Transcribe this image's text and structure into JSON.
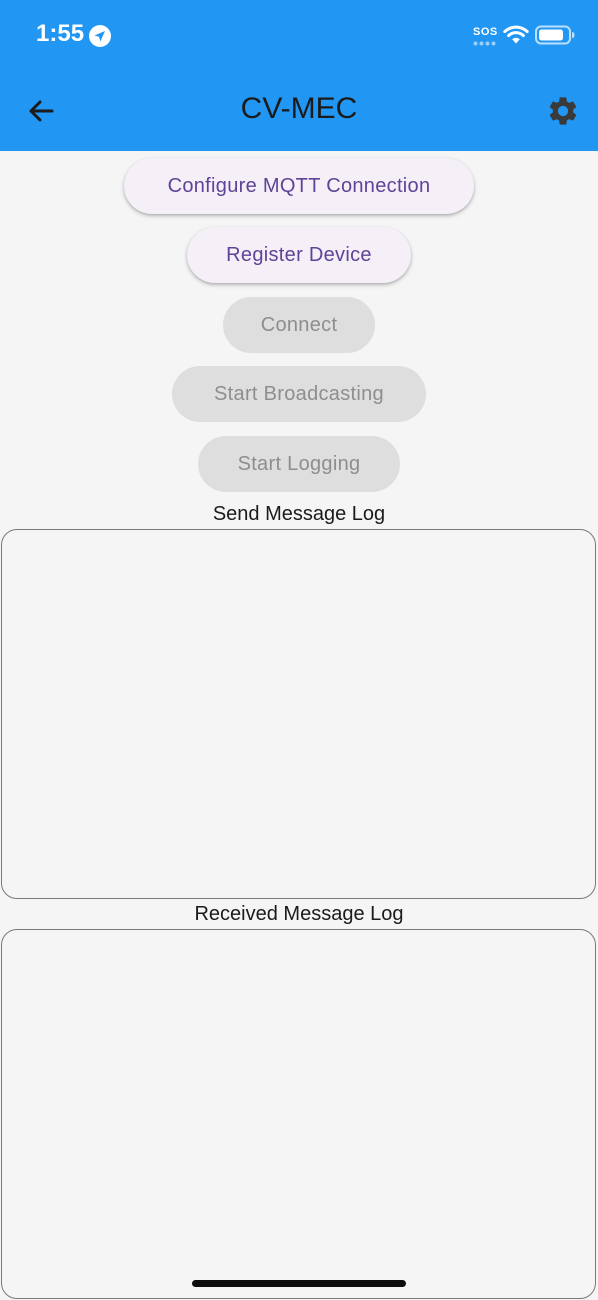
{
  "status_bar": {
    "time": "1:55",
    "sos": "SOS",
    "icons": [
      "location-arrow-icon",
      "wifi-icon",
      "battery-icon"
    ]
  },
  "app_bar": {
    "title": "CV-MEC",
    "back_icon": "arrow-left-icon",
    "settings_icon": "gear-icon",
    "color": "#2196f3"
  },
  "buttons": {
    "configure_mqtt": "Configure MQTT Connection",
    "register_device": "Register Device",
    "connect": "Connect",
    "start_broadcasting": "Start Broadcasting",
    "start_logging": "Start Logging"
  },
  "button_states": {
    "configure_mqtt": "enabled",
    "register_device": "enabled",
    "connect": "disabled",
    "start_broadcasting": "disabled",
    "start_logging": "disabled"
  },
  "logs": {
    "send_label": "Send Message Log",
    "received_label": "Received Message Log",
    "send_content": "",
    "received_content": ""
  },
  "colors": {
    "button_text_active": "#5f4397",
    "button_bg_active": "#f5eff8",
    "button_bg_disabled": "#dedede",
    "button_text_disabled": "#8e8e8e"
  }
}
